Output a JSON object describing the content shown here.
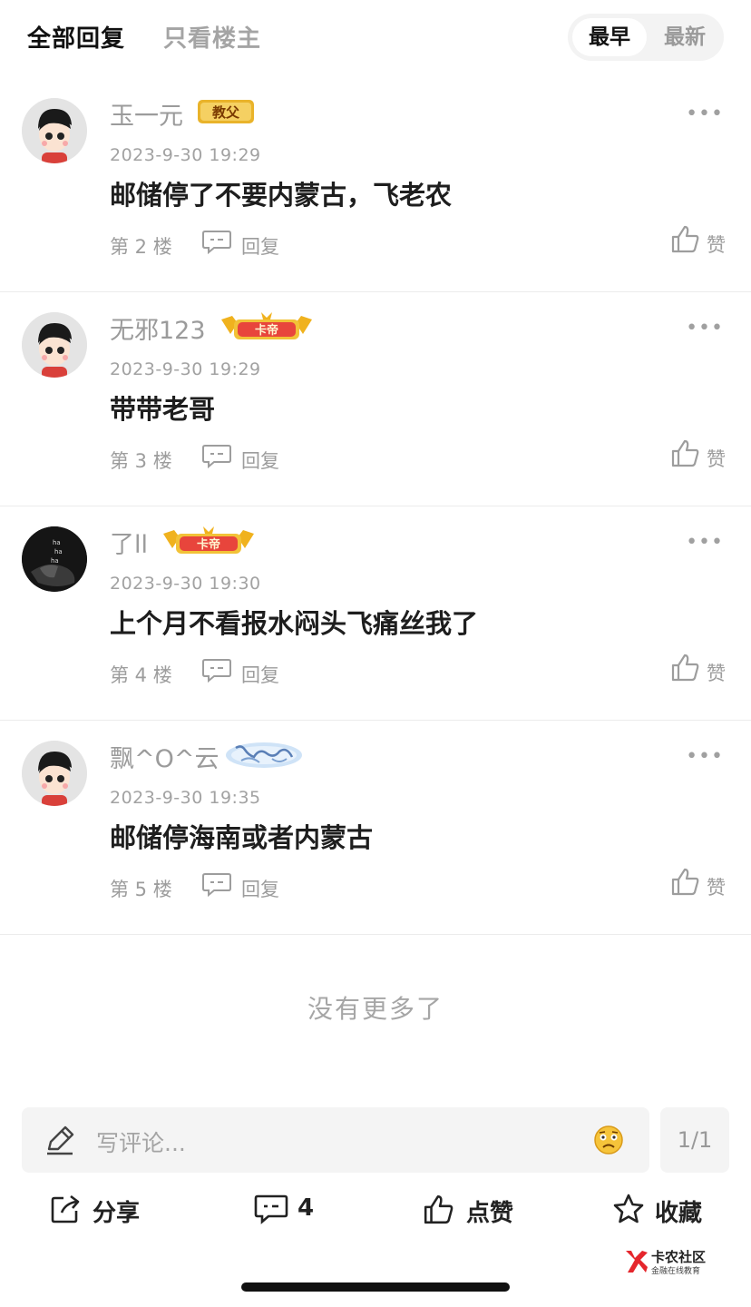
{
  "filter": {
    "all_replies": "全部回复",
    "op_only": "只看楼主",
    "sort_earliest": "最早",
    "sort_latest": "最新"
  },
  "comments": [
    {
      "username": "玉一元",
      "badge": "教父",
      "time": "2023-9-30 19:29",
      "content": "邮储停了不要内蒙古，飞老农",
      "floor": "第 2 楼",
      "reply": "回复",
      "like": "赞",
      "more": "•••"
    },
    {
      "username": "无邪123",
      "badge": "卡帝",
      "time": "2023-9-30 19:29",
      "content": "带带老哥",
      "floor": "第 3 楼",
      "reply": "回复",
      "like": "赞",
      "more": "•••"
    },
    {
      "username": "了ll",
      "badge": "卡帝",
      "time": "2023-9-30 19:30",
      "content": "上个月不看报水闷头飞痛丝我了",
      "floor": "第 4 楼",
      "reply": "回复",
      "like": "赞",
      "more": "•••"
    },
    {
      "username": "飘^O^云",
      "badge": "",
      "time": "2023-9-30 19:35",
      "content": "邮储停海南或者内蒙古",
      "floor": "第 5 楼",
      "reply": "回复",
      "like": "赞",
      "more": "•••"
    }
  ],
  "footer_note": "没有更多了",
  "composer": {
    "placeholder": "写评论...",
    "page": "1/1"
  },
  "actions": {
    "share": "分享",
    "comments_count": "4",
    "like": "点赞",
    "favorite": "收藏"
  },
  "watermark": {
    "brand": "卡农社区",
    "tagline": "金融在线教育"
  },
  "colors": {
    "badge_gold": "#e0a21a",
    "badge_red": "#e8453c",
    "text_gray": "#9d9d9d",
    "brand_red": "#e5262c"
  }
}
